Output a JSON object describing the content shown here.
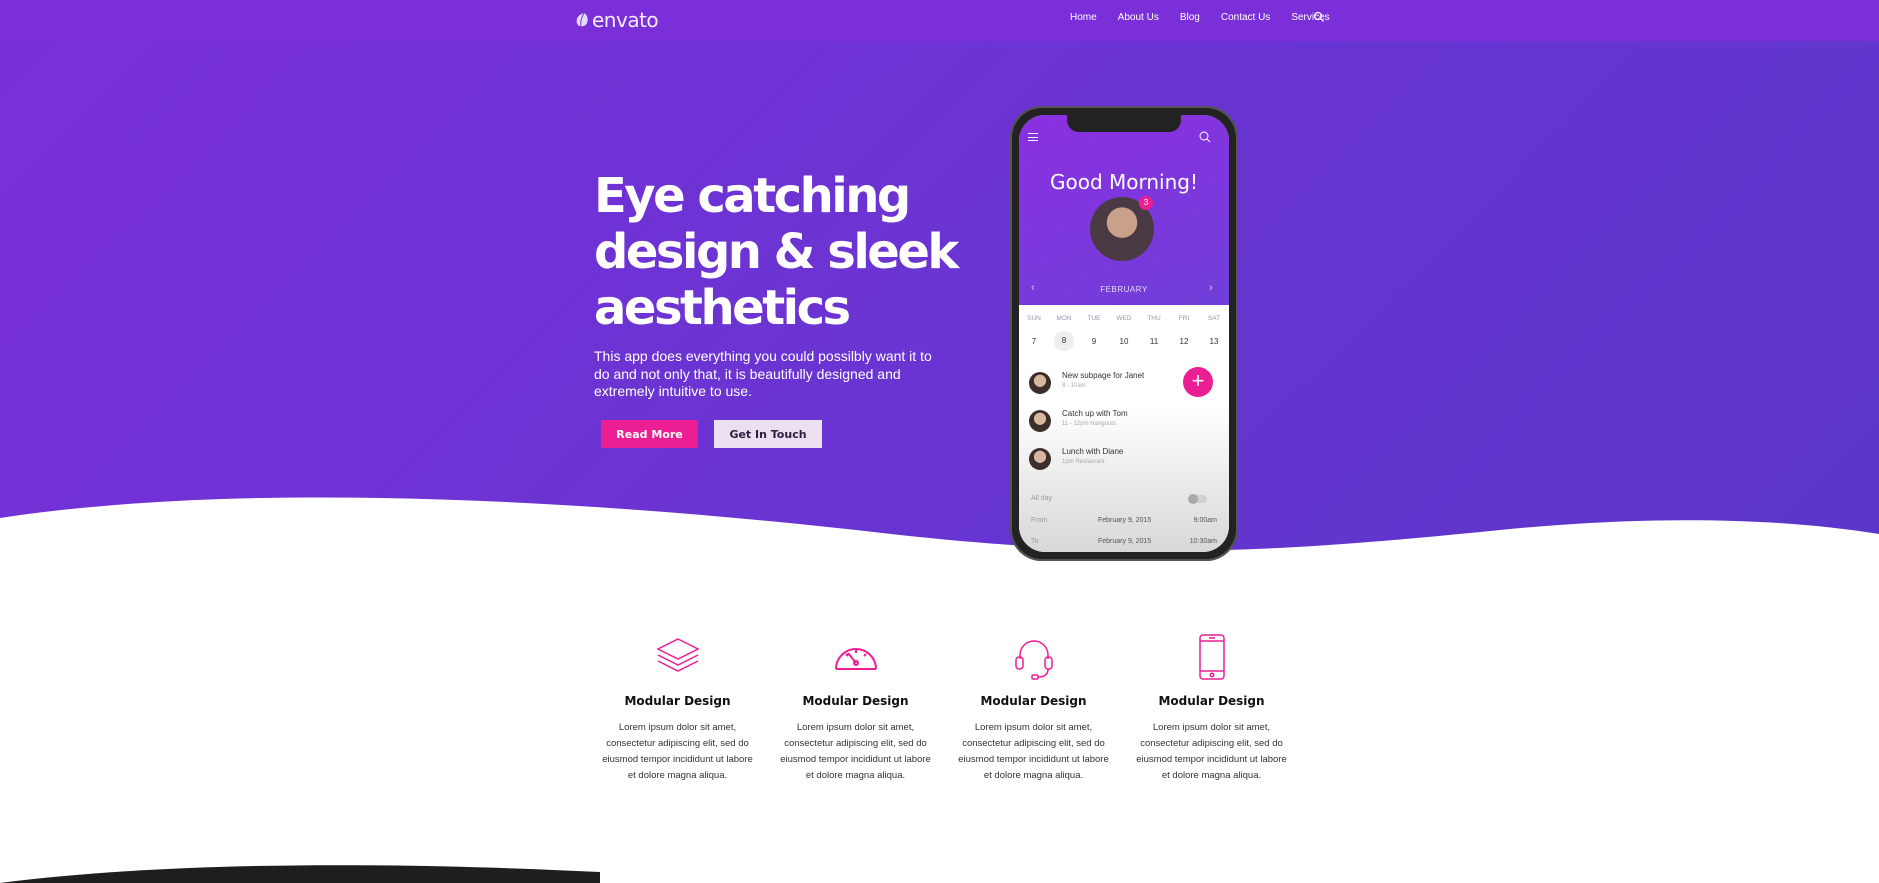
{
  "brand": {
    "logo_text": "envato"
  },
  "nav": {
    "items": [
      "Home",
      "About Us",
      "Blog",
      "Contact Us",
      "Services"
    ]
  },
  "hero": {
    "headline_line1": "Eye catching",
    "headline_line2": "design & sleek",
    "headline_line3": "aesthetics",
    "subtext": "This app does everything you could possilbly want it to do and not only that, it is beautifully designed and extremely intuitive to use.",
    "primary_button": "Read More",
    "secondary_button": "Get In Touch"
  },
  "phone": {
    "greeting": "Good Morning!",
    "badge_count": "3",
    "month": "FEBRUARY",
    "weekdays": [
      "SUN",
      "MON",
      "TUE",
      "WED",
      "THU",
      "FRI",
      "SAT"
    ],
    "dates": [
      "7",
      "8",
      "9",
      "10",
      "11",
      "12",
      "13"
    ],
    "selected_date": "8",
    "events": [
      {
        "title": "New subpage for Janet",
        "sub": "8 - 10am"
      },
      {
        "title": "Catch up with Tom",
        "sub": "11 - 12pm   Hangouts"
      },
      {
        "title": "Lunch with Diane",
        "sub": "1pm   Restaurant"
      }
    ],
    "all_day_label": "All day",
    "from_label": "From",
    "from_date": "February 9, 2015",
    "from_time": "9:00am",
    "to_label": "To",
    "to_date": "February 9, 2015",
    "to_time": "10:30am"
  },
  "features": [
    {
      "icon": "layers-icon",
      "title": "Modular Design",
      "text": "Lorem ipsum dolor sit amet, consectetur adipiscing elit, sed do eiusmod tempor incididunt ut labore et dolore magna aliqua."
    },
    {
      "icon": "speedometer-icon",
      "title": "Modular Design",
      "text": "Lorem ipsum dolor sit amet, consectetur adipiscing elit, sed do eiusmod tempor incididunt ut labore et dolore magna aliqua."
    },
    {
      "icon": "headset-icon",
      "title": "Modular Design",
      "text": "Lorem ipsum dolor sit amet, consectetur adipiscing elit, sed do eiusmod tempor incididunt ut labore et dolore magna aliqua."
    },
    {
      "icon": "smartphone-icon",
      "title": "Modular Design",
      "text": "Lorem ipsum dolor sit amet, consectetur adipiscing elit, sed do eiusmod tempor incididunt ut labore et dolore magna aliqua."
    }
  ],
  "colors": {
    "hero_purple": "#7a2fd8",
    "accent_pink": "#ec1e93",
    "secondary_button_bg": "#ecdff0",
    "footer_dark": "#1e1e1e"
  }
}
